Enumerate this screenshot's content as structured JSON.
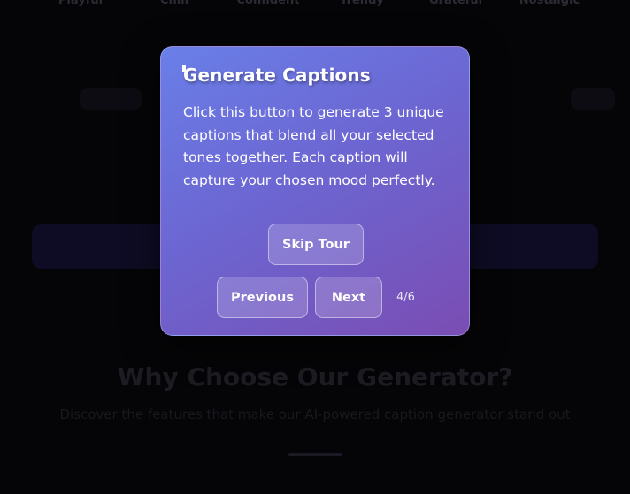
{
  "background": {
    "tones": [
      "Playful",
      "Chill",
      "Confident",
      "Trendy",
      "Grateful",
      "Nostalgic"
    ],
    "section_title": "Why Choose Our Generator?",
    "section_subtitle": "Discover the features that make our AI-powered caption generator stand out"
  },
  "tour": {
    "title": "Generate Captions",
    "body": "Click this button to generate 3 unique captions that blend all your selected tones together. Each caption will capture your chosen mood perfectly.",
    "skip_label": "Skip Tour",
    "previous_label": "Previous",
    "next_label": "Next",
    "step_counter": "4/6"
  },
  "colors": {
    "page_background": "#050507",
    "tour_gradient_start": "#6a7fe8",
    "tour_gradient_end": "#7a4db3"
  }
}
